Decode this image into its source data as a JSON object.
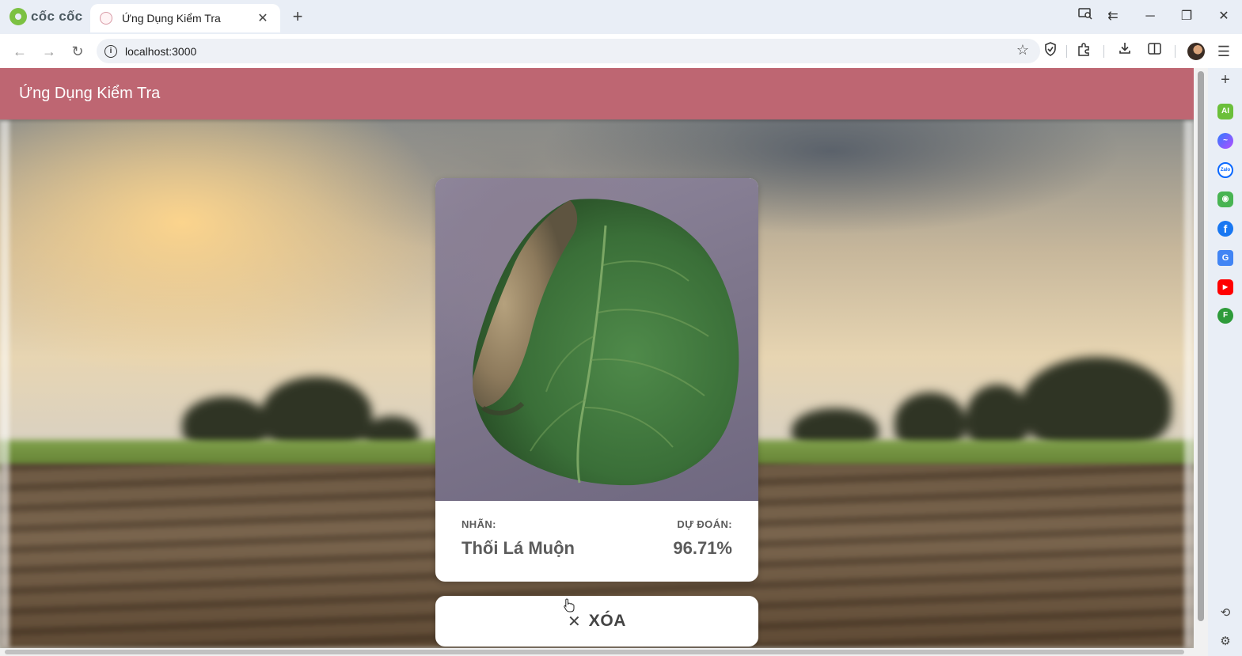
{
  "browser": {
    "brand": "cốc cốc",
    "tab_title": "Ứng Dụng Kiểm Tra",
    "tab_close": "✕",
    "new_tab": "+",
    "url": "localhost:3000"
  },
  "app": {
    "title": "Ứng Dụng Kiểm Tra",
    "accent_color": "#be6672"
  },
  "result": {
    "label_heading": "NHÃN:",
    "label_value": "Thối Lá Muộn",
    "prediction_heading": "DỰ ĐOÁN:",
    "prediction_value": "96.71%"
  },
  "clear_button": {
    "icon": "✕",
    "label": "XÓA"
  },
  "sidebar": {
    "ai_label": "AI",
    "zalo_label": "Zalo",
    "f_label": "F"
  },
  "icons": [
    "back-icon",
    "forward-icon",
    "reload-icon",
    "info-icon",
    "star-icon",
    "shield-icon",
    "extensions-icon",
    "download-icon",
    "split-view-icon",
    "menu-icon",
    "history-icon",
    "settings-icon"
  ]
}
